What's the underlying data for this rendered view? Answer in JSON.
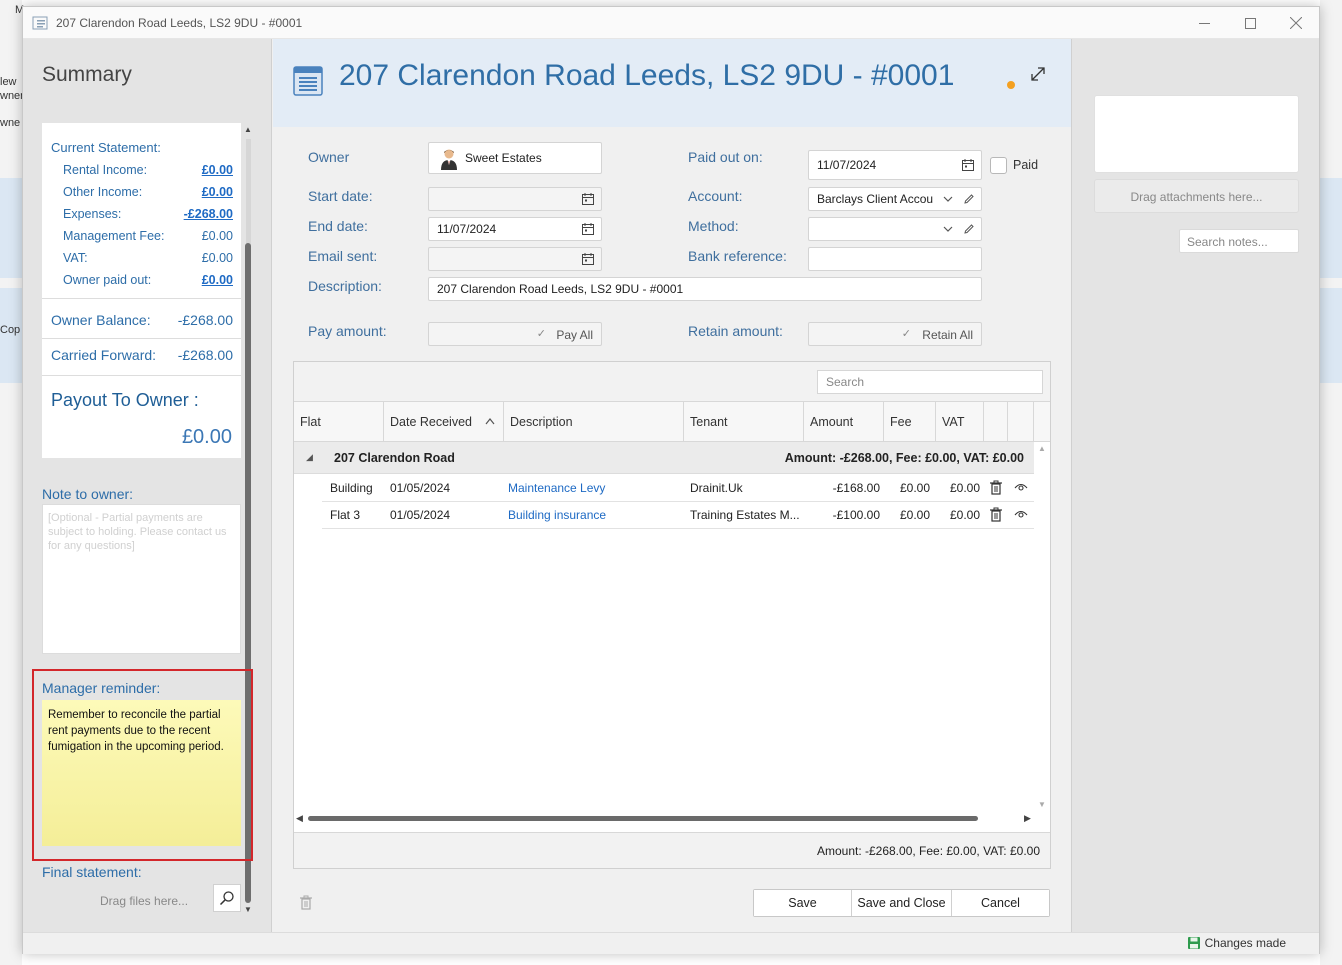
{
  "window": {
    "title": "207 Clarendon Road Leeds, LS2 9DU - #0001"
  },
  "background": {
    "left_labels": [
      "M",
      "lew",
      "wner",
      "wne",
      "Cop"
    ]
  },
  "summary": {
    "title": "Summary",
    "current_statement_label": "Current Statement:",
    "rows": [
      {
        "label": "Rental Income:",
        "value": "£0.00"
      },
      {
        "label": "Other Income:",
        "value": "£0.00"
      },
      {
        "label": "Expenses:",
        "value": "-£268.00"
      },
      {
        "label": "Management Fee:",
        "value": "£0.00"
      },
      {
        "label": "VAT:",
        "value": "£0.00"
      },
      {
        "label": "Owner paid out:",
        "value": "£0.00"
      }
    ],
    "owner_balance_label": "Owner Balance:",
    "owner_balance_value": "-£268.00",
    "carried_forward_label": "Carried Forward:",
    "carried_forward_value": "-£268.00",
    "payout_label": "Payout To Owner :",
    "payout_value": "£0.00",
    "note_label": "Note to owner:",
    "note_placeholder": "[Optional - Partial payments are subject to holding. Please contact us for any questions]",
    "reminder_label": "Manager reminder:",
    "reminder_text": "Remember to reconcile the partial rent payments due to the recent fumigation in the upcoming period.",
    "final_statement_label": "Final statement:",
    "drag_files_text": "Drag files here..."
  },
  "header": {
    "title": "207 Clarendon Road Leeds, LS2 9DU - #0001"
  },
  "form": {
    "owner_label": "Owner",
    "owner_value": "Sweet Estates",
    "start_date_label": "Start date:",
    "start_date_value": "",
    "end_date_label": "End date:",
    "end_date_value": "11/07/2024",
    "email_sent_label": "Email sent:",
    "email_sent_value": "",
    "description_label": "Description:",
    "description_value": "207 Clarendon Road Leeds, LS2 9DU - #0001",
    "pay_amount_label": "Pay amount:",
    "pay_all_label": "Pay All",
    "paid_out_on_label": "Paid out on:",
    "paid_out_on_value": "11/07/2024",
    "paid_label": "Paid",
    "account_label": "Account:",
    "account_value": "Barclays Client Accou",
    "method_label": "Method:",
    "method_value": "",
    "bank_reference_label": "Bank reference:",
    "bank_reference_value": "",
    "retain_amount_label": "Retain amount:",
    "retain_all_label": "Retain All"
  },
  "grid": {
    "search_placeholder": "Search",
    "columns": [
      "Flat",
      "Date Received",
      "Description",
      "Tenant",
      "Amount",
      "Fee",
      "VAT"
    ],
    "group": {
      "name": "207 Clarendon Road",
      "summary": "Amount: -£268.00,   Fee: £0.00,   VAT: £0.00"
    },
    "rows": [
      {
        "flat": "Building",
        "date": "01/05/2024",
        "description": "Maintenance Levy",
        "tenant": "Drainit.Uk",
        "amount": "-£168.00",
        "fee": "£0.00",
        "vat": "£0.00"
      },
      {
        "flat": "Flat 3",
        "date": "01/05/2024",
        "description": "Building insurance",
        "tenant": "Training Estates M...",
        "amount": "-£100.00",
        "fee": "£0.00",
        "vat": "£0.00"
      }
    ],
    "footer": "Amount: -£268.00, Fee: £0.00, VAT: £0.00"
  },
  "buttons": {
    "save": "Save",
    "save_close": "Save and Close",
    "cancel": "Cancel"
  },
  "attachments": {
    "drag_text": "Drag attachments here...",
    "search_notes_placeholder": "Search notes..."
  },
  "status": {
    "changes_text": "Changes made"
  },
  "colors": {
    "accent_blue": "#2f6ea6",
    "link_blue": "#1e6ac4",
    "reminder_yellow": "#fdfab9",
    "highlight_red": "#d3272b",
    "status_dot": "#f4a020",
    "saved_green": "#2e9b4d"
  }
}
